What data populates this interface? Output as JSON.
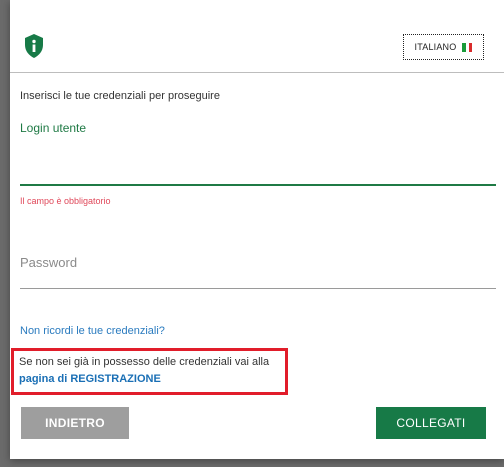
{
  "header": {
    "language_label": "ITALIANO",
    "flag_colors": [
      "#1a9b3a",
      "#ffffff",
      "#d92b2b"
    ],
    "logo_icon": "shield-info-icon",
    "brand_color": "#177a47"
  },
  "form": {
    "intro": "Inserisci le tue credenziali per proseguire",
    "user_label": "Login utente",
    "user_value": "",
    "user_error": "Il campo è obbligatorio",
    "password_placeholder": "Password",
    "forgot_link": "Non ricordi le tue credenziali?",
    "registration_text": "Se non sei già in possesso delle credenziali vai alla",
    "registration_link": "pagina di REGISTRAZIONE"
  },
  "actions": {
    "back_label": "INDIETRO",
    "connect_label": "COLLEGATI"
  }
}
